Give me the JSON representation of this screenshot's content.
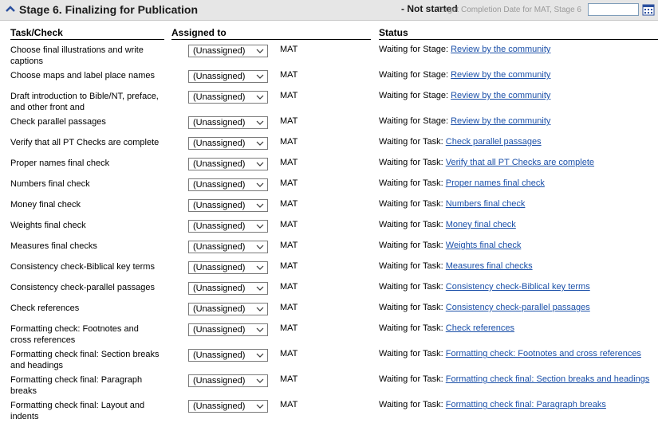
{
  "header": {
    "title": "Stage 6. Finalizing for Publication",
    "status": "- Not started",
    "target_label": "Target Completion Date for MAT, Stage 6",
    "date_value": ""
  },
  "columns": {
    "task": "Task/Check",
    "assigned": "Assigned to",
    "status": "Status"
  },
  "rows": [
    {
      "task": "Choose final illustrations and write captions",
      "assigned": "(Unassigned)",
      "project": "MAT",
      "status_prefix": "Waiting for Stage:",
      "status_link": "Review by the community"
    },
    {
      "task": "Choose maps and label place names",
      "assigned": "(Unassigned)",
      "project": "MAT",
      "status_prefix": "Waiting for Stage:",
      "status_link": "Review by the community"
    },
    {
      "task": "Draft introduction to Bible/NT, preface, and other front and",
      "assigned": "(Unassigned)",
      "project": "MAT",
      "status_prefix": "Waiting for Stage:",
      "status_link": "Review by the community"
    },
    {
      "task": "Check parallel passages",
      "assigned": "(Unassigned)",
      "project": "MAT",
      "status_prefix": "Waiting for Stage:",
      "status_link": "Review by the community"
    },
    {
      "task": "Verify that all PT Checks are complete",
      "assigned": "(Unassigned)",
      "project": "MAT",
      "status_prefix": "Waiting for Task:",
      "status_link": "Check parallel passages"
    },
    {
      "task": "Proper names final check",
      "assigned": "(Unassigned)",
      "project": "MAT",
      "status_prefix": "Waiting for Task:",
      "status_link": "Verify that all PT Checks are complete"
    },
    {
      "task": "Numbers final check",
      "assigned": "(Unassigned)",
      "project": "MAT",
      "status_prefix": "Waiting for Task:",
      "status_link": "Proper names final check"
    },
    {
      "task": "Money final check",
      "assigned": "(Unassigned)",
      "project": "MAT",
      "status_prefix": "Waiting for Task:",
      "status_link": "Numbers final check"
    },
    {
      "task": "Weights final check",
      "assigned": "(Unassigned)",
      "project": "MAT",
      "status_prefix": "Waiting for Task:",
      "status_link": "Money final check"
    },
    {
      "task": "Measures final checks",
      "assigned": "(Unassigned)",
      "project": "MAT",
      "status_prefix": "Waiting for Task:",
      "status_link": "Weights final check"
    },
    {
      "task": "Consistency check-Biblical key terms",
      "assigned": "(Unassigned)",
      "project": "MAT",
      "status_prefix": "Waiting for Task:",
      "status_link": "Measures final checks"
    },
    {
      "task": "Consistency check-parallel passages",
      "assigned": "(Unassigned)",
      "project": "MAT",
      "status_prefix": "Waiting for Task:",
      "status_link": "Consistency check-Biblical key terms"
    },
    {
      "task": "Check references",
      "assigned": "(Unassigned)",
      "project": "MAT",
      "status_prefix": "Waiting for Task:",
      "status_link": "Consistency check-parallel passages"
    },
    {
      "task": "Formatting check: Footnotes and cross references",
      "assigned": "(Unassigned)",
      "project": "MAT",
      "status_prefix": "Waiting for Task:",
      "status_link": "Check references"
    },
    {
      "task": "Formatting check final: Section breaks and headings",
      "assigned": "(Unassigned)",
      "project": "MAT",
      "status_prefix": "Waiting for Task:",
      "status_link": "Formatting check: Footnotes and cross references"
    },
    {
      "task": "Formatting check final: Paragraph breaks",
      "assigned": "(Unassigned)",
      "project": "MAT",
      "status_prefix": "Waiting for Task:",
      "status_link": "Formatting check final: Section breaks and headings"
    },
    {
      "task": "Formatting check final: Layout and indents",
      "assigned": "(Unassigned)",
      "project": "MAT",
      "status_prefix": "Waiting for Task:",
      "status_link": "Formatting check final: Paragraph breaks"
    }
  ]
}
